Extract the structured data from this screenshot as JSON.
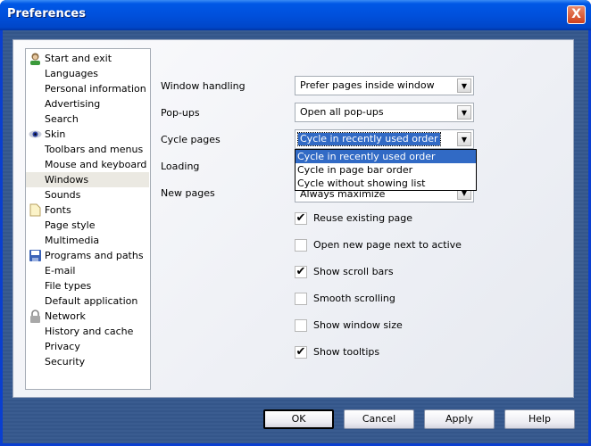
{
  "window": {
    "title": "Preferences",
    "close": "X"
  },
  "sidebar": {
    "items": [
      {
        "label": "Start and exit",
        "icon": "person-icon"
      },
      {
        "label": "Languages"
      },
      {
        "label": "Personal information"
      },
      {
        "label": "Advertising"
      },
      {
        "label": "Search"
      },
      {
        "label": "Skin",
        "icon": "eye-icon"
      },
      {
        "label": "Toolbars and menus"
      },
      {
        "label": "Mouse and keyboard"
      },
      {
        "label": "Windows",
        "selected": true
      },
      {
        "label": "Sounds"
      },
      {
        "label": "Fonts",
        "icon": "document-icon"
      },
      {
        "label": "Page style"
      },
      {
        "label": "Multimedia"
      },
      {
        "label": "Programs and paths",
        "icon": "floppy-icon"
      },
      {
        "label": "E-mail"
      },
      {
        "label": "File types"
      },
      {
        "label": "Default application"
      },
      {
        "label": "Network",
        "icon": "lock-icon"
      },
      {
        "label": "History and cache"
      },
      {
        "label": "Privacy"
      },
      {
        "label": "Security"
      }
    ]
  },
  "settings": {
    "window_handling": {
      "label": "Window handling",
      "value": "Prefer pages inside window"
    },
    "popups": {
      "label": "Pop-ups",
      "value": "Open all pop-ups"
    },
    "cycle_pages": {
      "label": "Cycle pages",
      "value": "Cycle in recently used order",
      "options": [
        "Cycle in recently used order",
        "Cycle in page bar order",
        "Cycle without showing list"
      ]
    },
    "loading": {
      "label": "Loading"
    },
    "new_pages": {
      "label": "New pages",
      "value": "Always maximize"
    }
  },
  "checkboxes": [
    {
      "label": "Reuse existing page",
      "checked": true
    },
    {
      "label": "Open new page next to active",
      "checked": false
    },
    {
      "label": "Show scroll bars",
      "checked": true
    },
    {
      "label": "Smooth scrolling",
      "checked": false
    },
    {
      "label": "Show window size",
      "checked": false
    },
    {
      "label": "Show tooltips",
      "checked": true
    }
  ],
  "buttons": {
    "ok": "OK",
    "cancel": "Cancel",
    "apply": "Apply",
    "help": "Help"
  }
}
